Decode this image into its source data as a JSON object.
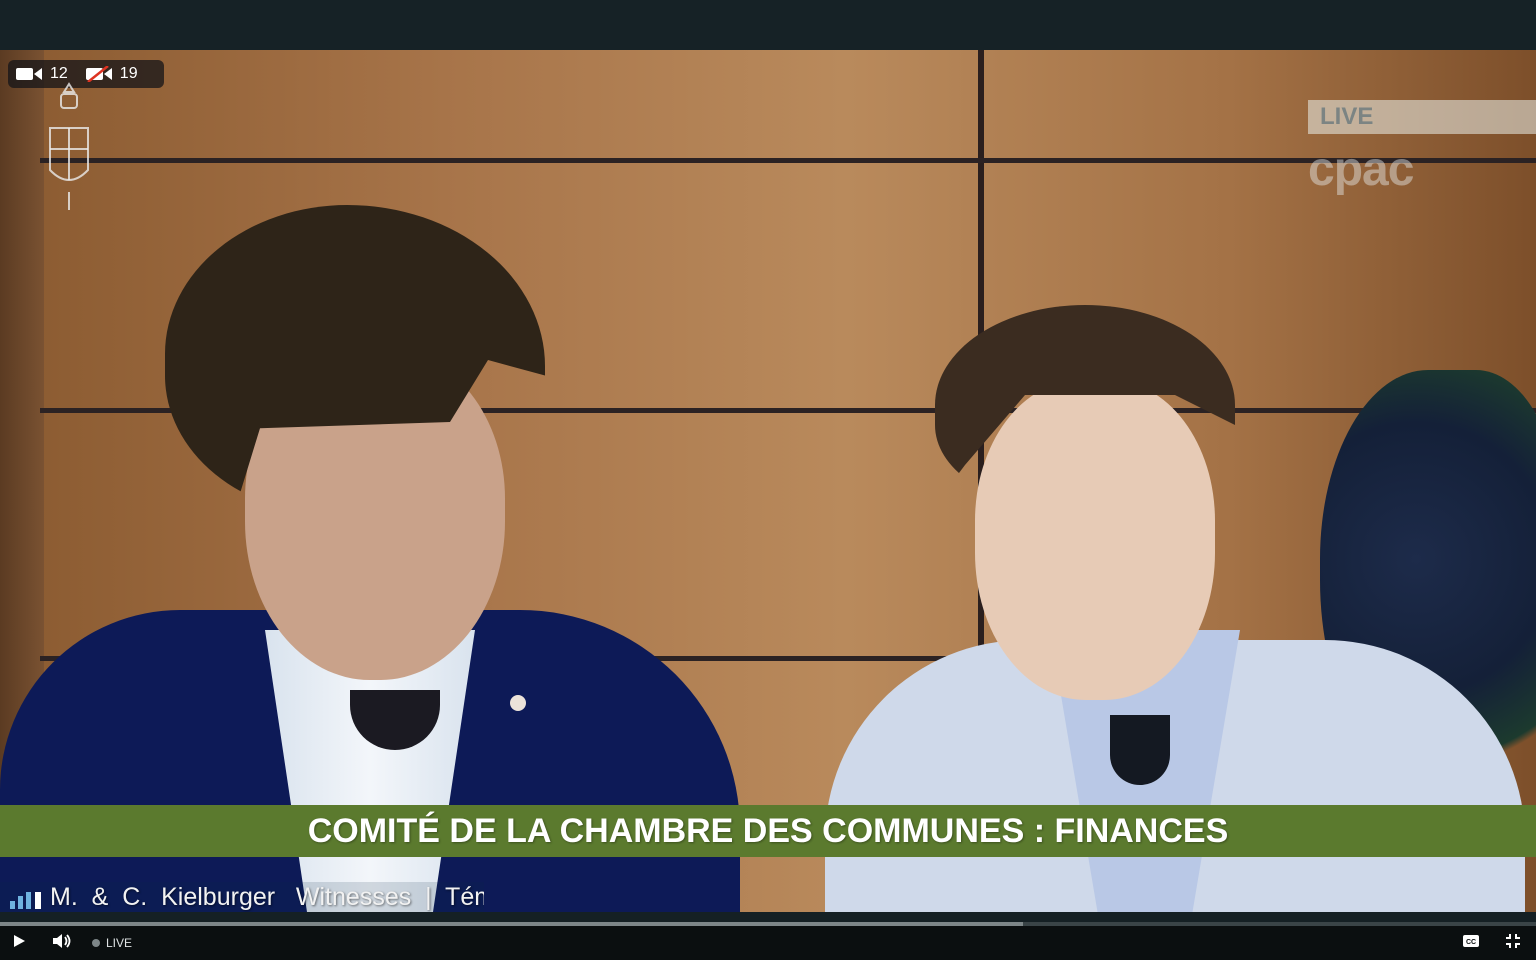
{
  "video": {
    "camera_on_count": "12",
    "camera_off_count": "19",
    "live_badge": "LIVE",
    "logo_text": "cpac",
    "title_band": "COMITÉ DE LA CHAMBRE DES COMMUNES : FINANCES",
    "name_strip": "M.  &  C.  Kielburger   Witnesses  |  Tém"
  },
  "controls": {
    "live_label": "LIVE",
    "progress": 0.666
  },
  "colors": {
    "title_band_bg": "#5b7a2e",
    "control_bar_bg": "#0b0f10",
    "top_bar_bg": "#162226"
  },
  "icons": {
    "play": "play-icon",
    "volume": "volume-icon",
    "captions": "closed-captions-icon",
    "exit_fullscreen": "exit-fullscreen-icon",
    "camera_on": "video-camera-icon",
    "camera_off": "video-camera-off-icon",
    "crest": "parliament-crest-icon",
    "signal": "signal-bars-icon"
  }
}
